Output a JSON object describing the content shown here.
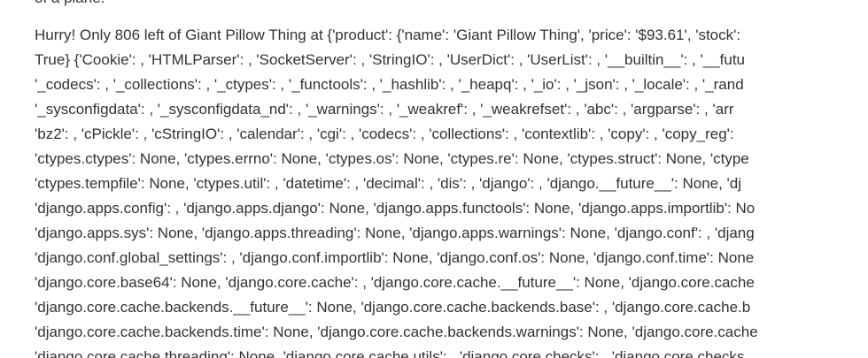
{
  "top_fragment": "of a plane.",
  "dump_lines": [
    "Hurry! Only 806 left of Giant Pillow Thing at {'product': {'name': 'Giant Pillow Thing', 'price': '$93.61', 'stock': ",
    "True} {'Cookie': , 'HTMLParser': , 'SocketServer': , 'StringIO': , 'UserDict': , 'UserList': , '__builtin__': , '__futu",
    "'_codecs': , '_collections': , '_ctypes': , '_functools': , '_hashlib': , '_heapq': , '_io': , '_json': , '_locale': , '_rand",
    "'_sysconfigdata': , '_sysconfigdata_nd': , '_warnings': , '_weakref': , '_weakrefset': , 'abc': , 'argparse': , 'arr",
    "'bz2': , 'cPickle': , 'cStringIO': , 'calendar': , 'cgi': , 'codecs': , 'collections': , 'contextlib': , 'copy': , 'copy_reg': ",
    "'ctypes.ctypes': None, 'ctypes.errno': None, 'ctypes.os': None, 'ctypes.re': None, 'ctypes.struct': None, 'ctype",
    "'ctypes.tempfile': None, 'ctypes.util': , 'datetime': , 'decimal': , 'dis': , 'django': , 'django.__future__': None, 'dj",
    "'django.apps.config': , 'django.apps.django': None, 'django.apps.functools': None, 'django.apps.importlib': No",
    "'django.apps.sys': None, 'django.apps.threading': None, 'django.apps.warnings': None, 'django.conf': , 'djang",
    "'django.conf.global_settings': , 'django.conf.importlib': None, 'django.conf.os': None, 'django.conf.time': None",
    "'django.core.base64': None, 'django.core.cache': , 'django.core.cache.__future__': None, 'django.core.cache",
    "'django.core.cache.backends.__future__': None, 'django.core.cache.backends.base': , 'django.core.cache.b",
    "'django.core.cache.backends.time': None, 'django.core.cache.backends.warnings': None, 'django.core.cache",
    "'django.core.cache.threading': None, 'django.core.cache.utils': , 'django.core.checks': , 'django.core.checks"
  ]
}
